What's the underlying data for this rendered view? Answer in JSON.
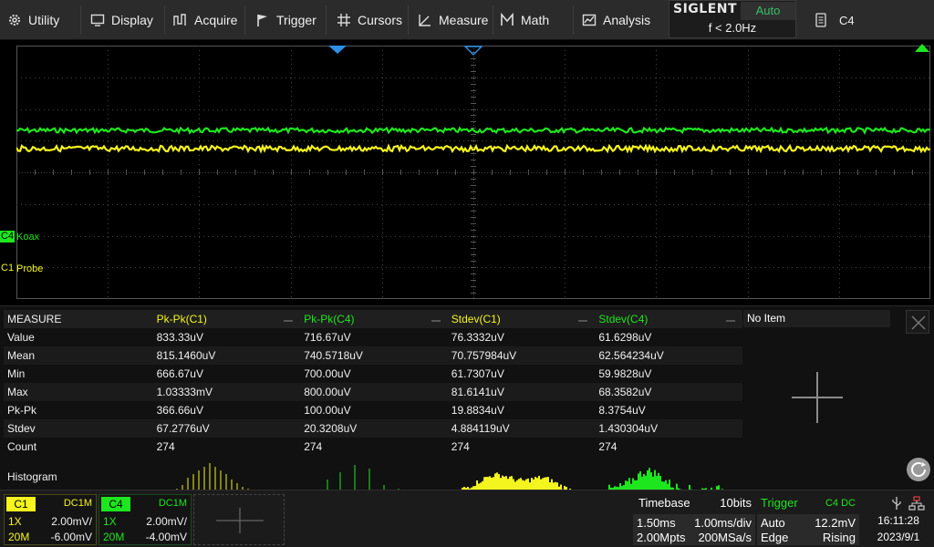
{
  "menu": {
    "utility": "Utility",
    "display": "Display",
    "acquire": "Acquire",
    "trigger": "Trigger",
    "cursors": "Cursors",
    "measure": "Measure",
    "math": "Math",
    "analysis": "Analysis"
  },
  "brand": {
    "logo": "SIGLENT",
    "trigger_mode": "Auto",
    "frequency": "f < 2.0Hz"
  },
  "active_channel": "C4",
  "channels_onscreen": {
    "c4": {
      "marker": "C4",
      "label": "Koax",
      "color": "#1ee61e"
    },
    "c1": {
      "marker": "C1",
      "label": "Probe",
      "color": "#f4f41e"
    }
  },
  "measure": {
    "header": [
      "MEASURE",
      "Pk-Pk(C1)",
      "Pk-Pk(C4)",
      "Stdev(C1)",
      "Stdev(C4)"
    ],
    "rows": [
      [
        "Value",
        "833.33uV",
        "716.67uV",
        "76.3332uV",
        "61.6298uV"
      ],
      [
        "Mean",
        "815.1460uV",
        "740.5718uV",
        "70.757984uV",
        "62.564234uV"
      ],
      [
        "Min",
        "666.67uV",
        "700.00uV",
        "61.7307uV",
        "59.9828uV"
      ],
      [
        "Max",
        "1.03333mV",
        "800.00uV",
        "81.6141uV",
        "68.3582uV"
      ],
      [
        "Pk-Pk",
        "366.66uV",
        "100.00uV",
        "19.8834uV",
        "8.3754uV"
      ],
      [
        "Stdev",
        "67.2776uV",
        "20.3208uV",
        "4.884119uV",
        "1.430304uV"
      ],
      [
        "Count",
        "274",
        "274",
        "274",
        "274"
      ]
    ],
    "histogram_label": "Histogram",
    "no_item": "No Item"
  },
  "channel_boxes": {
    "c1": {
      "badge": "C1",
      "coupling": "DC1M",
      "probe": "1X",
      "vdiv": "2.00mV/",
      "bw": "20M",
      "offset": "-6.00mV"
    },
    "c4": {
      "badge": "C4",
      "coupling": "DC1M",
      "probe": "1X",
      "vdiv": "2.00mV/",
      "bw": "20M",
      "offset": "-4.00mV"
    }
  },
  "timebase": {
    "label": "Timebase",
    "bits": "10bits",
    "delay": "1.50ms",
    "tdiv": "1.00ms/div",
    "mem": "2.00Mpts",
    "srate": "200MSa/s"
  },
  "trigger": {
    "label": "Trigger",
    "source": "C4 DC",
    "mode": "Auto",
    "level": "12.2mV",
    "type": "Edge",
    "slope": "Rising"
  },
  "clock": {
    "time": "16:11:28",
    "date": "2023/9/1"
  },
  "colors": {
    "c1": "#f4f41e",
    "c4": "#1ee61e",
    "trigger_marker": "#2f8fe6"
  }
}
